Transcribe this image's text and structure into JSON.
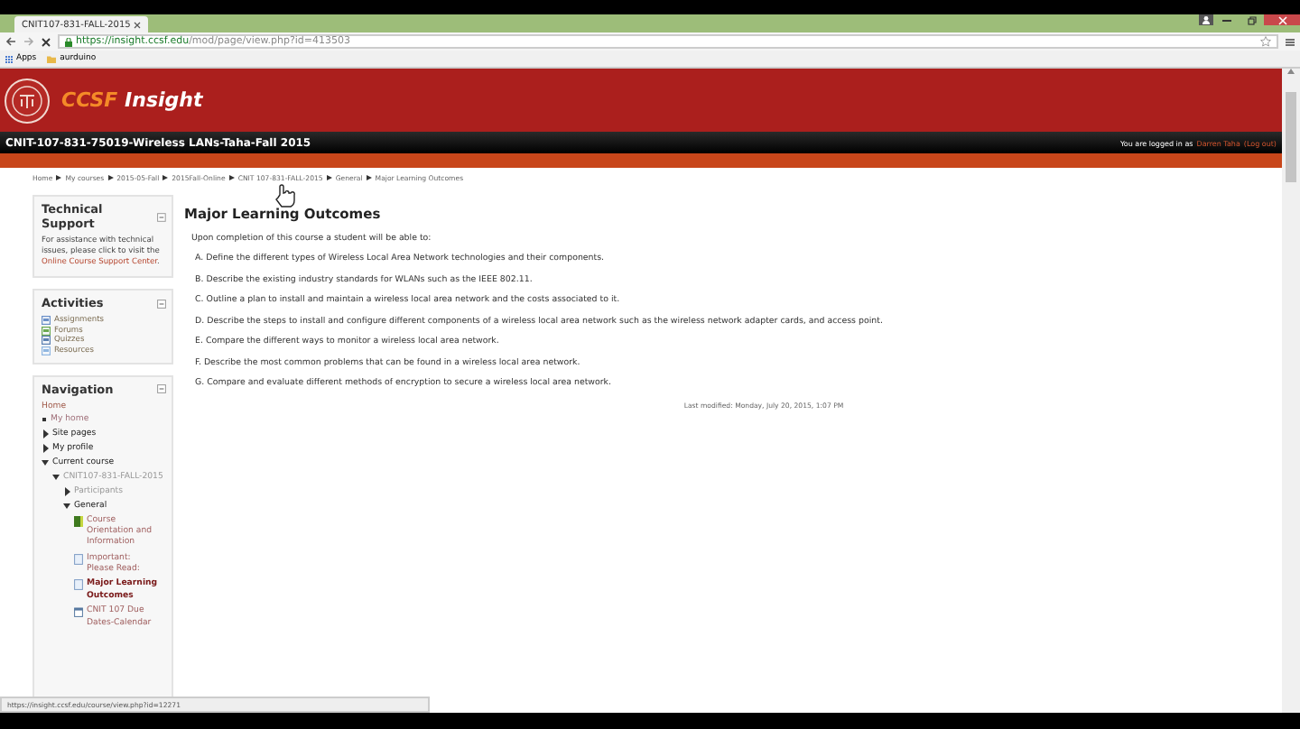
{
  "browser": {
    "tab_title": "CNIT107-831-FALL-2015",
    "url_host": "https://insight.ccsf.edu",
    "url_path": "/mod/page/view.php?id=413503",
    "bookmarks": [
      {
        "label": "Apps",
        "kind": "apps"
      },
      {
        "label": "aurduino",
        "kind": "folder"
      }
    ]
  },
  "site": {
    "title_a": "CCSF",
    "title_b": "Insight"
  },
  "course_bar": {
    "title": "CNIT-107-831-75019-Wireless LANs-Taha-Fall 2015",
    "login_text": "You are logged in as",
    "user": "Darren Taha",
    "logout": "(Log out)"
  },
  "breadcrumb": [
    {
      "label": "Home"
    },
    {
      "label": "My courses"
    },
    {
      "label": "2015-05-Fall"
    },
    {
      "label": "2015Fall-Online"
    },
    {
      "label": "CNIT 107-831-FALL-2015"
    },
    {
      "label": "General"
    },
    {
      "label": "Major Learning Outcomes"
    }
  ],
  "technical_support": {
    "title": "Technical Support",
    "text": "For assistance with technical issues, please click to visit the",
    "link": "Online Course Support Center",
    "after": "."
  },
  "activities": {
    "title": "Activities",
    "items": [
      {
        "label": "Assignments",
        "kind": "assignment"
      },
      {
        "label": "Forums",
        "kind": "forum"
      },
      {
        "label": "Quizzes",
        "kind": "quiz"
      },
      {
        "label": "Resources",
        "kind": "resource"
      }
    ]
  },
  "navigation": {
    "title": "Navigation",
    "items": [
      {
        "label": "Home",
        "kind": "root",
        "selected": false
      },
      {
        "label": "My home",
        "kind": "bullet",
        "selected": false
      },
      {
        "label": "Site pages",
        "kind": "branch",
        "expanded": false,
        "selected": false
      },
      {
        "label": "My profile",
        "kind": "branch",
        "expanded": false,
        "selected": false
      },
      {
        "label": "Current course",
        "kind": "branch",
        "expanded": true,
        "selected": false,
        "children": [
          {
            "label": "CNIT107-831-FALL-2015",
            "kind": "course",
            "expanded": true,
            "selected": false,
            "children": [
              {
                "label": "Participants",
                "kind": "course",
                "expanded": false,
                "selected": false
              },
              {
                "label": "General",
                "kind": "branch",
                "expanded": true,
                "selected": false,
                "children": [
                  {
                    "label": "Course Orientation and Information",
                    "kind": "book",
                    "selected": false
                  },
                  {
                    "label": "Important: Please Read:",
                    "kind": "page",
                    "selected": false
                  },
                  {
                    "label": "Major Learning Outcomes",
                    "kind": "page",
                    "selected": true
                  },
                  {
                    "label": "CNIT 107 Due Dates-Calendar",
                    "kind": "calendar",
                    "selected": false
                  }
                ]
              }
            ]
          }
        ]
      }
    ]
  },
  "main": {
    "heading": "Major Learning Outcomes",
    "intro": "Upon completion of this course a student will be able to:",
    "outcomes": [
      {
        "letter": "A.",
        "text": "Define the different types of Wireless Local Area Network technologies and their components."
      },
      {
        "letter": "B.",
        "text": "Describe the existing industry standards for WLANs such as the IEEE 802.11."
      },
      {
        "letter": "C.",
        "text": "Outline a plan to install and maintain a wireless local area network and the costs associated to it."
      },
      {
        "letter": "D.",
        "text": "Describe the steps to install and configure different components of a wireless local area network such as the wireless network adapter cards, and access point."
      },
      {
        "letter": "E.",
        "text": "Compare the different ways to monitor a wireless local area network."
      },
      {
        "letter": "F.",
        "text": "Describe the most common problems that can be found in a wireless local area network."
      },
      {
        "letter": "G.",
        "text": "Compare and evaluate different methods of encryption to secure a wireless local area network."
      }
    ],
    "last_modified": "Last modified: Monday, July 20, 2015, 1:07 PM"
  },
  "status_bar": {
    "url": "https://insight.ccsf.edu/course/view.php?id=12271"
  }
}
